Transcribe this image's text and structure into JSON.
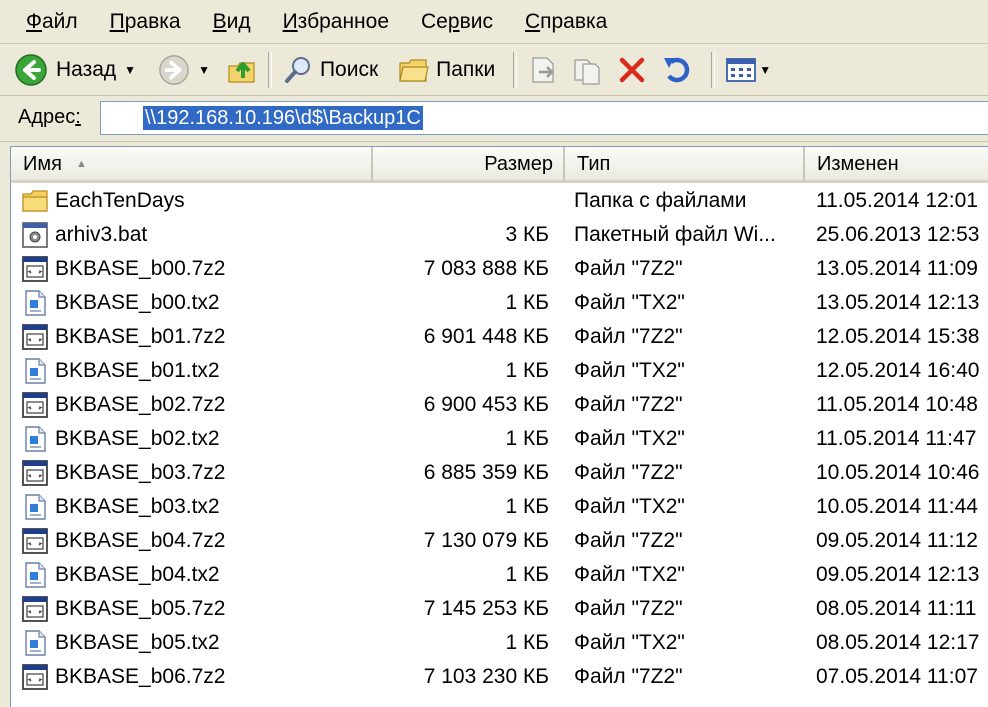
{
  "menu": {
    "items": [
      {
        "accel": "Ф",
        "rest": "айл"
      },
      {
        "accel": "П",
        "rest": "равка"
      },
      {
        "accel": "В",
        "rest": "ид"
      },
      {
        "accel": "И",
        "rest": "збранное"
      },
      {
        "pre": "Се",
        "accel": "р",
        "rest": "вис"
      },
      {
        "accel": "С",
        "rest": "правка"
      }
    ]
  },
  "toolbar": {
    "back_label": "Назад",
    "search_label": "Поиск",
    "folders_label": "Папки"
  },
  "address": {
    "label_text": "Адрес",
    "label_accel": ":",
    "value": "\\\\192.168.10.196\\d$\\Backup1C"
  },
  "columns": {
    "name": "Имя",
    "size": "Размер",
    "type": "Тип",
    "modified": "Изменен"
  },
  "files": [
    {
      "icon": "folder-icon",
      "name": "EachTenDays",
      "size": "",
      "type": "Папка с файлами",
      "modified": "11.05.2014 12:01"
    },
    {
      "icon": "batch-file-icon",
      "name": "arhiv3.bat",
      "size": "3 КБ",
      "type": "Пакетный файл Wi...",
      "modified": "25.06.2013 12:53"
    },
    {
      "icon": "archive-file-icon",
      "name": "BKBASE_b00.7z2",
      "size": "7 083 888 КБ",
      "type": "Файл \"7Z2\"",
      "modified": "13.05.2014 11:09"
    },
    {
      "icon": "text-file-icon",
      "name": "BKBASE_b00.tx2",
      "size": "1 КБ",
      "type": "Файл \"TX2\"",
      "modified": "13.05.2014 12:13"
    },
    {
      "icon": "archive-file-icon",
      "name": "BKBASE_b01.7z2",
      "size": "6 901 448 КБ",
      "type": "Файл \"7Z2\"",
      "modified": "12.05.2014 15:38"
    },
    {
      "icon": "text-file-icon",
      "name": "BKBASE_b01.tx2",
      "size": "1 КБ",
      "type": "Файл \"TX2\"",
      "modified": "12.05.2014 16:40"
    },
    {
      "icon": "archive-file-icon",
      "name": "BKBASE_b02.7z2",
      "size": "6 900 453 КБ",
      "type": "Файл \"7Z2\"",
      "modified": "11.05.2014 10:48"
    },
    {
      "icon": "text-file-icon",
      "name": "BKBASE_b02.tx2",
      "size": "1 КБ",
      "type": "Файл \"TX2\"",
      "modified": "11.05.2014 11:47"
    },
    {
      "icon": "archive-file-icon",
      "name": "BKBASE_b03.7z2",
      "size": "6 885 359 КБ",
      "type": "Файл \"7Z2\"",
      "modified": "10.05.2014 10:46"
    },
    {
      "icon": "text-file-icon",
      "name": "BKBASE_b03.tx2",
      "size": "1 КБ",
      "type": "Файл \"TX2\"",
      "modified": "10.05.2014 11:44"
    },
    {
      "icon": "archive-file-icon",
      "name": "BKBASE_b04.7z2",
      "size": "7 130 079 КБ",
      "type": "Файл \"7Z2\"",
      "modified": "09.05.2014 11:12"
    },
    {
      "icon": "text-file-icon",
      "name": "BKBASE_b04.tx2",
      "size": "1 КБ",
      "type": "Файл \"TX2\"",
      "modified": "09.05.2014 12:13"
    },
    {
      "icon": "archive-file-icon",
      "name": "BKBASE_b05.7z2",
      "size": "7 145 253 КБ",
      "type": "Файл \"7Z2\"",
      "modified": "08.05.2014 11:11"
    },
    {
      "icon": "text-file-icon",
      "name": "BKBASE_b05.tx2",
      "size": "1 КБ",
      "type": "Файл \"TX2\"",
      "modified": "08.05.2014 12:17"
    },
    {
      "icon": "archive-file-icon",
      "name": "BKBASE_b06.7z2",
      "size": "7 103 230 КБ",
      "type": "Файл \"7Z2\"",
      "modified": "07.05.2014 11:07"
    }
  ]
}
